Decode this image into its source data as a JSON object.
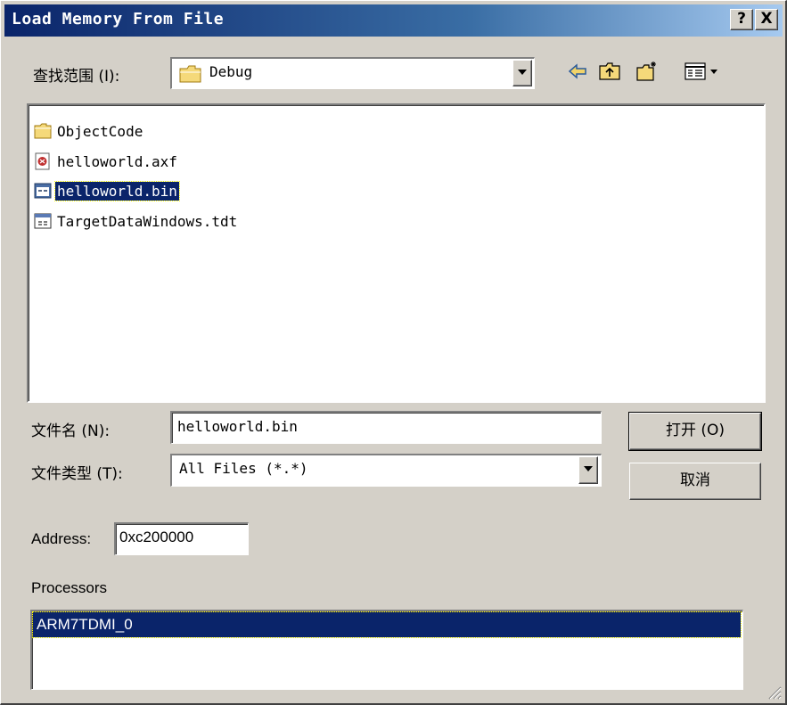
{
  "window": {
    "title": "Load Memory From File",
    "help_label": "?",
    "close_label": "X"
  },
  "look_in": {
    "label": "查找范围 (I):",
    "value": "Debug"
  },
  "toolbar": {
    "back": "back-arrow-icon",
    "up": "up-folder-icon",
    "new_folder": "new-folder-icon",
    "view": "view-menu-icon"
  },
  "files": [
    {
      "name": "ObjectCode",
      "icon": "folder-icon"
    },
    {
      "name": "helloworld.axf",
      "icon": "axf-file-icon"
    },
    {
      "name": "helloworld.bin",
      "icon": "bin-file-icon",
      "selected": true
    },
    {
      "name": "TargetDataWindows.tdt",
      "icon": "tdt-file-icon"
    }
  ],
  "file_name": {
    "label": "文件名 (N):",
    "value": "helloworld.bin"
  },
  "file_type": {
    "label": "文件类型 (T):",
    "value": "All Files (*.*)"
  },
  "buttons": {
    "open": "打开 (O)",
    "cancel": "取消"
  },
  "address": {
    "label": "Address:",
    "value": "0xc200000"
  },
  "processors": {
    "label": "Processors",
    "items": [
      "ARM7TDMI_0"
    ]
  },
  "colors": {
    "title_start": "#0a246a",
    "title_end": "#a6caf0",
    "face": "#d4d0c8",
    "selection": "#0a246a"
  }
}
